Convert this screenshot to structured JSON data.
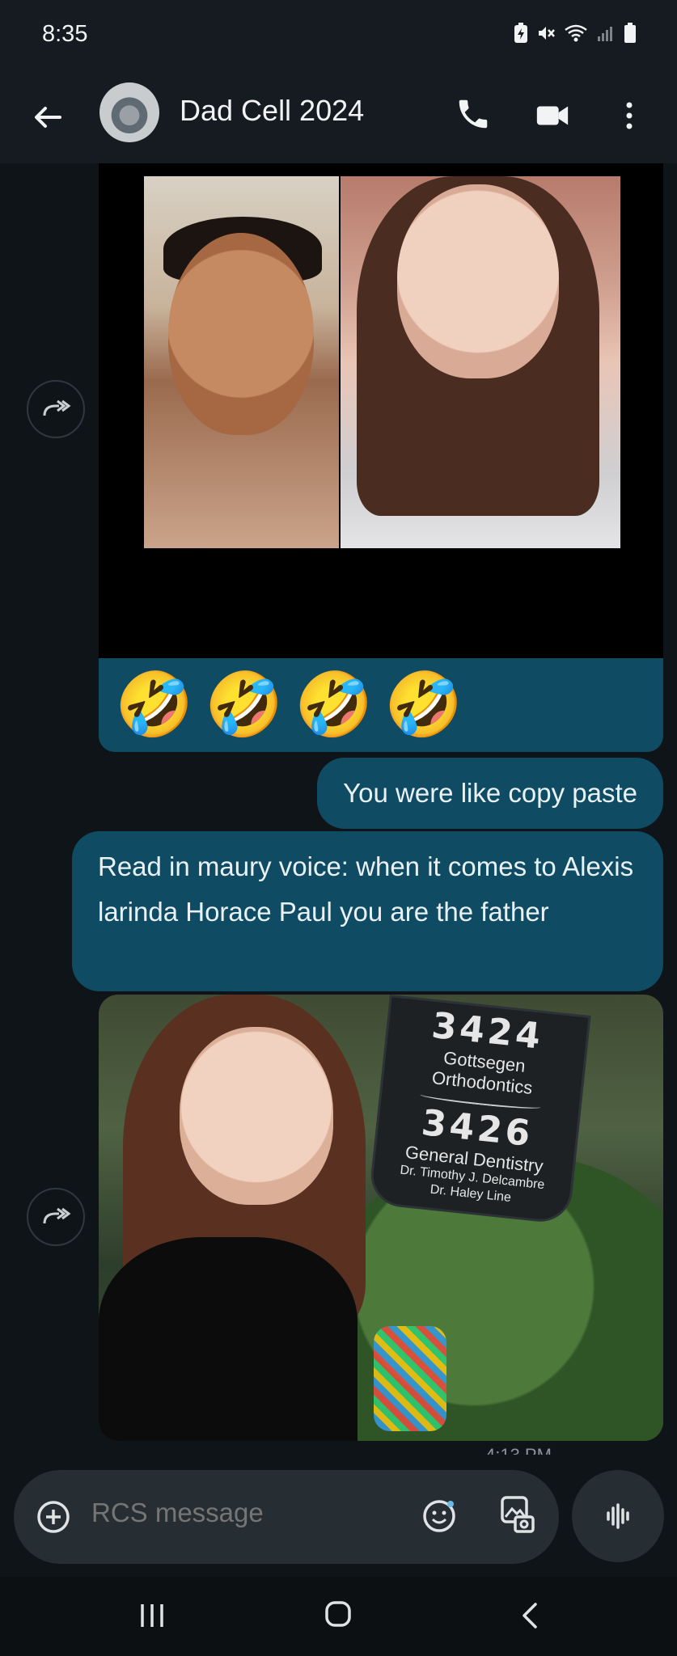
{
  "status_bar": {
    "time": "8:35"
  },
  "header": {
    "contact_name": "Dad Cell 2024",
    "icons": [
      "back-arrow-icon",
      "phone-icon",
      "video-icon",
      "more-vert-icon"
    ]
  },
  "messages": [
    {
      "type": "image",
      "direction": "incoming",
      "description_icon": "forward-icon"
    },
    {
      "type": "emoji",
      "direction": "outgoing",
      "emojis": [
        "🤣",
        "🤣",
        "🤣",
        "🤣"
      ]
    },
    {
      "type": "text",
      "direction": "outgoing",
      "text": "You were like copy paste"
    },
    {
      "type": "text",
      "direction": "outgoing",
      "text": "Read in maury voice: when it comes to Alexis larinda Horace Paul you are the father"
    },
    {
      "type": "image",
      "direction": "incoming",
      "sign": {
        "num1": "3424",
        "line1": "Gottsegen",
        "line2": "Orthodontics",
        "num2": "3426",
        "line3": "General Dentistry",
        "line4": "Dr. Timothy J. Delcambre",
        "line5": "Dr. Haley Line"
      }
    }
  ],
  "meta_partial": "4:13 PM",
  "composer": {
    "placeholder": "RCS message"
  },
  "colors": {
    "bubble": "#0f4c63",
    "background": "#0f1418",
    "bar": "#151b20"
  }
}
